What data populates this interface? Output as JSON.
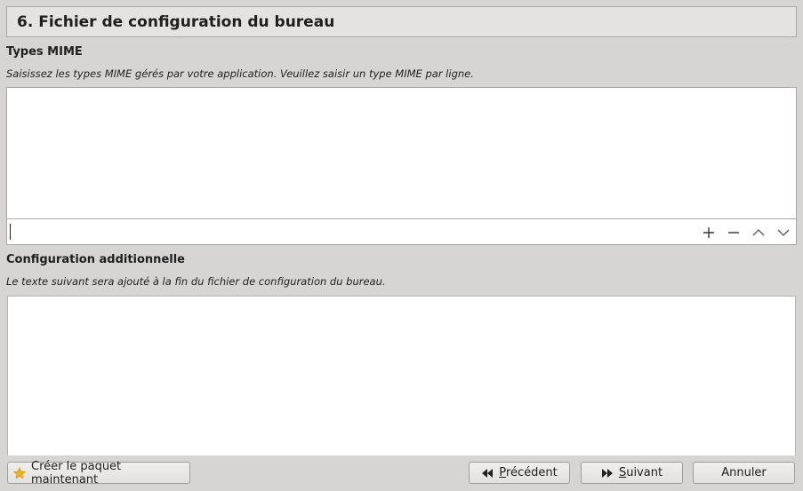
{
  "header": {
    "title": "6. Fichier de configuration du bureau"
  },
  "mime": {
    "title": "Types MIME",
    "description": "Saisissez les types MIME gérés par votre application. Veuillez saisir un type MIME par ligne.",
    "entry_value": "",
    "items": [],
    "tools": [
      "plus-icon",
      "minus-icon",
      "chevron-up-icon",
      "chevron-down-icon"
    ]
  },
  "additional": {
    "title": "Configuration additionnelle",
    "description": "Le texte suivant sera ajouté à la fin du fichier de configuration du bureau.",
    "content": ""
  },
  "buttons": {
    "create_label": "Créer le paquet maintenant",
    "create_icon": "star-icon",
    "previous_label": "Précédent",
    "previous_icon": "rewind-icon",
    "next_label": "Suivant",
    "next_icon": "fast-forward-icon",
    "cancel_label": "Annuler"
  },
  "colors": {
    "window_bg": "#d6d5d4",
    "field_bg": "#ffffff",
    "star": "#f0b21a"
  }
}
